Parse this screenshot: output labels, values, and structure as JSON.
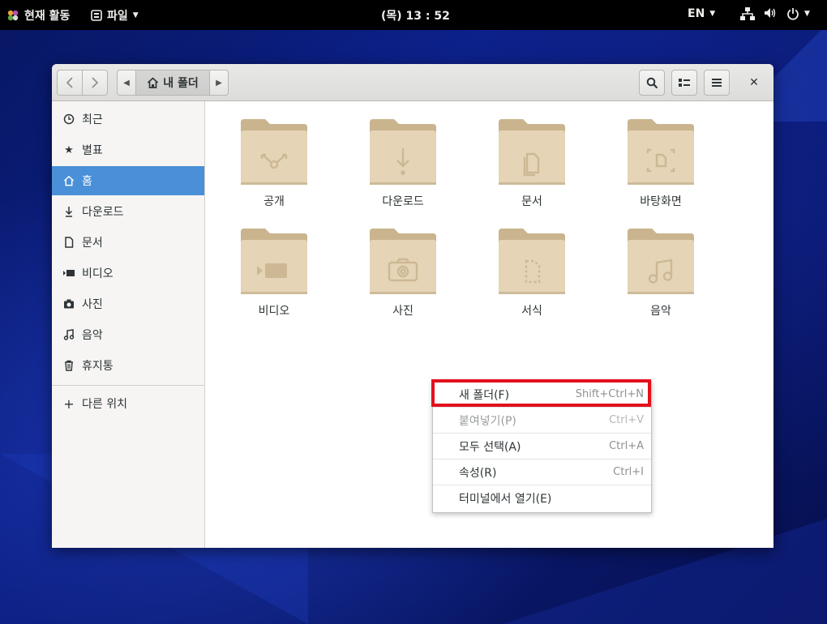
{
  "topbar": {
    "activities": "현재 활동",
    "app_menu": "파일",
    "clock": "(목) 13 : 52",
    "language": "EN"
  },
  "headerbar": {
    "path_home_label": "내 폴더"
  },
  "sidebar": {
    "items": [
      {
        "label": "최근",
        "icon": "clock-icon"
      },
      {
        "label": "별표",
        "icon": "star-icon"
      },
      {
        "label": "홈",
        "icon": "home-icon"
      },
      {
        "label": "다운로드",
        "icon": "download-icon"
      },
      {
        "label": "문서",
        "icon": "document-icon"
      },
      {
        "label": "비디오",
        "icon": "video-icon"
      },
      {
        "label": "사진",
        "icon": "camera-icon"
      },
      {
        "label": "음악",
        "icon": "music-icon"
      },
      {
        "label": "휴지통",
        "icon": "trash-icon"
      }
    ],
    "other_locations": "다른 위치",
    "active_index": 2
  },
  "folders": [
    {
      "label": "공개",
      "emblem": "share-icon"
    },
    {
      "label": "다운로드",
      "emblem": "download-icon"
    },
    {
      "label": "문서",
      "emblem": "document-icon"
    },
    {
      "label": "바탕화면",
      "emblem": "desktop-icon"
    },
    {
      "label": "비디오",
      "emblem": "video-icon"
    },
    {
      "label": "사진",
      "emblem": "camera-icon"
    },
    {
      "label": "서식",
      "emblem": "template-icon"
    },
    {
      "label": "음악",
      "emblem": "music-icon"
    }
  ],
  "context_menu": {
    "items": [
      {
        "label": "새 폴더(F)",
        "accel": "Shift+Ctrl+N",
        "enabled": true
      },
      {
        "label": "붙여넣기(P)",
        "accel": "Ctrl+V",
        "enabled": false
      },
      {
        "label": "모두 선택(A)",
        "accel": "Ctrl+A",
        "enabled": true
      },
      {
        "label": "속성(R)",
        "accel": "Ctrl+I",
        "enabled": true
      },
      {
        "label": "터미널에서 열기(E)",
        "accel": "",
        "enabled": true
      }
    ]
  },
  "colors": {
    "accent": "#4a90d9",
    "folder": "#e5d4b6",
    "folder_tab": "#c9b48e",
    "highlight": "#e3101d"
  }
}
